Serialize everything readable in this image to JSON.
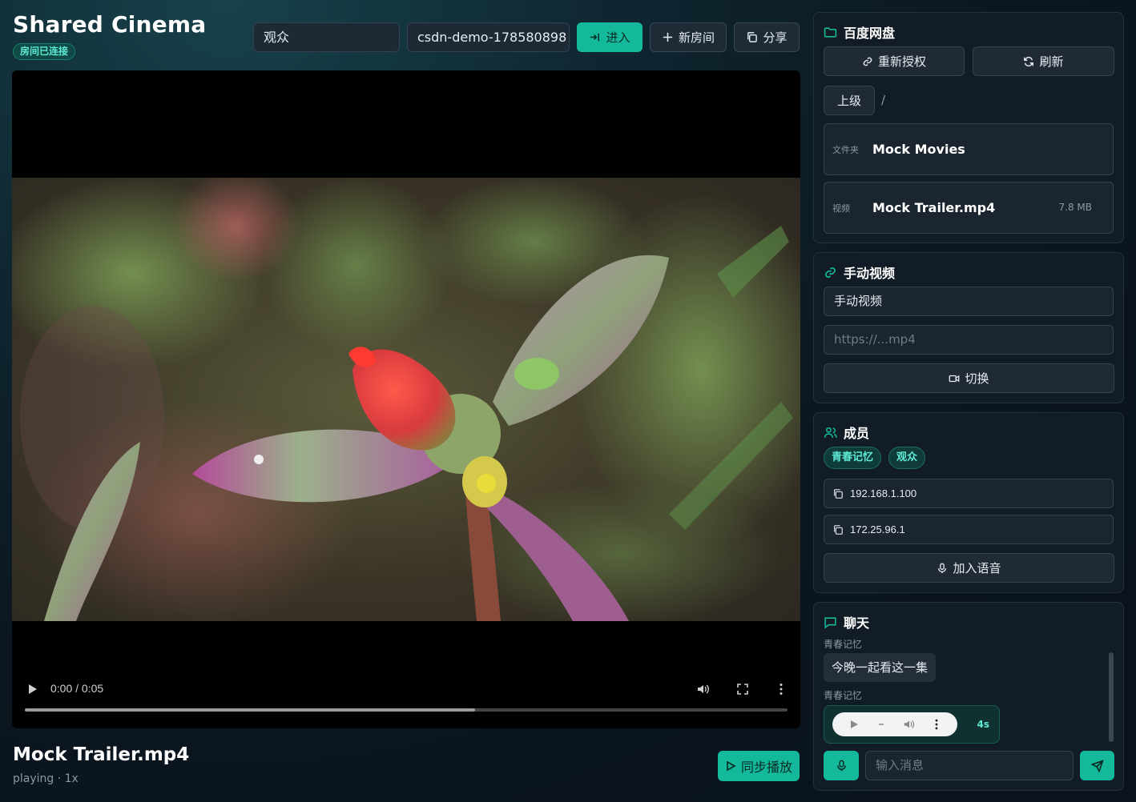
{
  "header": {
    "app_title": "Shared Cinema",
    "status_badge": "房间已连接",
    "role_value": "观众",
    "room_id_value": "csdn-demo-178580898",
    "enter_label": "进入",
    "new_room_label": "新房间",
    "share_label": "分享"
  },
  "player": {
    "time_display": "0:00 / 0:05",
    "progress_fraction": 0.59,
    "title": "Mock Trailer.mp4",
    "status": "playing · 1x",
    "sync_label": "同步播放"
  },
  "baidu": {
    "title": "百度网盘",
    "reauth_label": "重新授权",
    "refresh_label": "刷新",
    "up_label": "上级",
    "path": "/",
    "files": [
      {
        "kind": "文件夹",
        "name": "Mock Movies",
        "size": ""
      },
      {
        "kind": "视频",
        "name": "Mock Trailer.mp4",
        "size": "7.8 MB"
      }
    ]
  },
  "manual": {
    "title": "手动视频",
    "name_value": "手动视频",
    "url_placeholder": "https://...mp4",
    "switch_label": "切换"
  },
  "members": {
    "title": "成员",
    "chips": [
      "青春记忆",
      "观众"
    ],
    "addresses": [
      "192.168.1.100",
      "172.25.96.1"
    ],
    "join_voice_label": "加入语音"
  },
  "chat": {
    "title": "聊天",
    "messages": [
      {
        "author": "青春记忆",
        "text": "今晚一起看这一集"
      },
      {
        "author": "青春记忆",
        "voice_duration": "4s"
      }
    ],
    "input_placeholder": "输入消息"
  },
  "colors": {
    "accent": "#14b89a",
    "accent_text": "#5eead4",
    "panel_bg": "#121c26"
  }
}
